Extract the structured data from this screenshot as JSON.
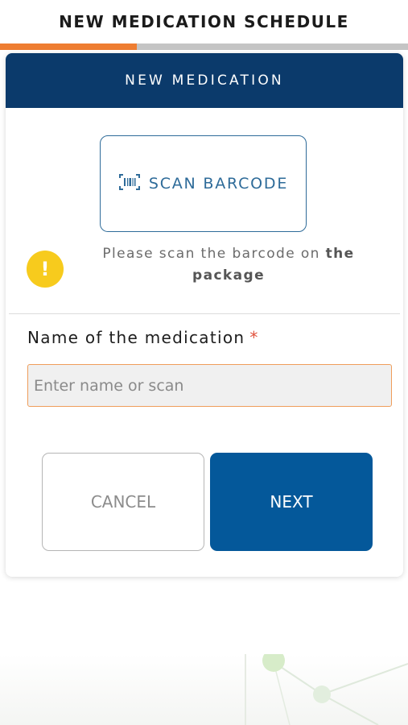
{
  "header": {
    "title": "NEW MEDICATION SCHEDULE"
  },
  "progress": {
    "fraction": 0.335,
    "fill_color": "#ee7d31",
    "track_color": "#c4c4c4"
  },
  "card": {
    "title": "NEW MEDICATION",
    "header_color": "#0b3a6b",
    "scan_button": {
      "label": "SCAN BARCODE",
      "icon": "barcode-icon"
    },
    "notice": {
      "icon": "warning-icon",
      "icon_glyph": "!",
      "text_regular": "Please scan the barcode on ",
      "text_bold": "the package"
    },
    "field": {
      "label": "Name of the medication",
      "required_mark": "*",
      "placeholder": "Enter name or scan",
      "value": ""
    },
    "cancel_label": "CANCEL",
    "next_label": "NEXT"
  },
  "colors": {
    "accent_blue": "#04589a",
    "warning_yellow": "#f7cb1d",
    "required_red": "#e0513c",
    "input_border": "#ef9d5a"
  }
}
